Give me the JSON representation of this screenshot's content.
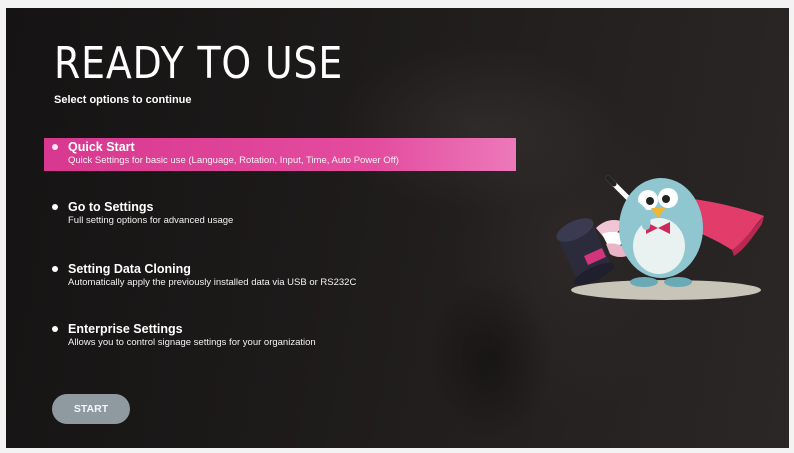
{
  "header": {
    "title": "READY TO USE",
    "subtitle": "Select options to continue"
  },
  "options": [
    {
      "title": "Quick Start",
      "description": "Quick Settings for basic use (Language, Rotation, Input, Time, Auto Power Off)",
      "selected": true
    },
    {
      "title": "Go to Settings",
      "description": "Full setting options for advanced usage",
      "selected": false
    },
    {
      "title": "Setting Data Cloning",
      "description": "Automatically apply the previously installed data via USB or RS232C",
      "selected": false
    },
    {
      "title": "Enterprise Settings",
      "description": "Allows you to control signage settings for your organization",
      "selected": false
    }
  ],
  "start_button": {
    "label": "START"
  },
  "colors": {
    "accent": "#e0439a",
    "button": "#8f9aa0",
    "background": "#1c1919"
  },
  "illustration": {
    "icon": "magician-bird-mascot-icon"
  }
}
